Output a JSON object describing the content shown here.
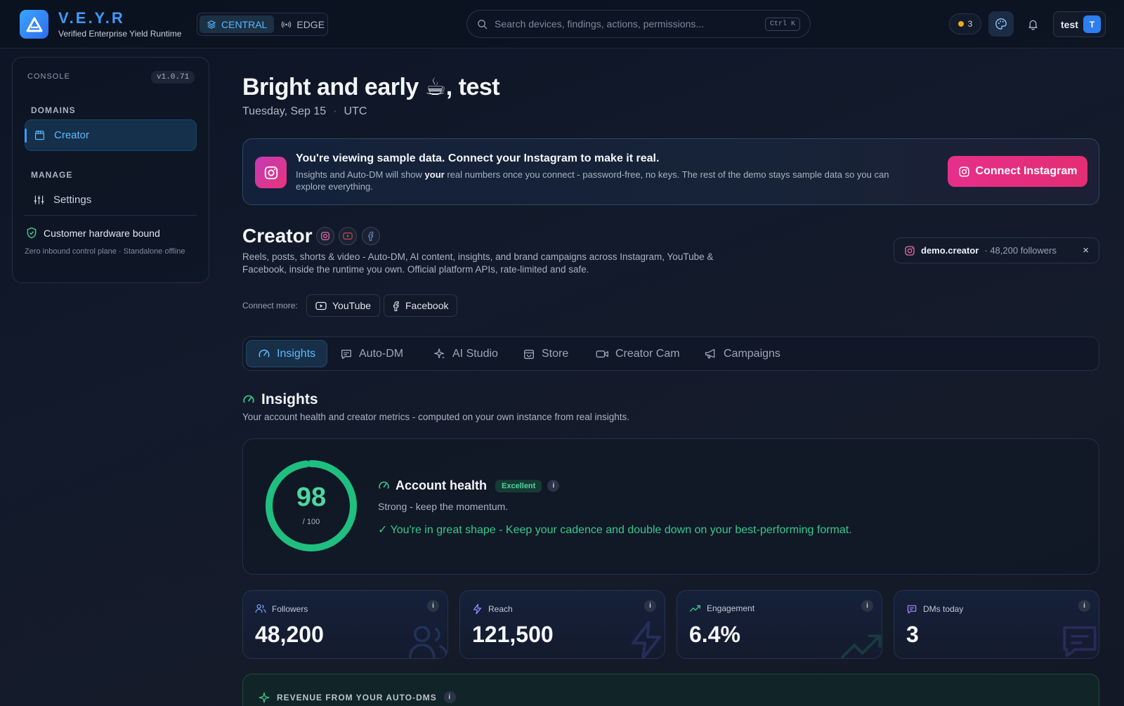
{
  "brand": {
    "name": "V.E.Y.R",
    "subtitle": "Verified Enterprise Yield Runtime"
  },
  "modes": [
    {
      "label": "CENTRAL",
      "active": true
    },
    {
      "label": "EDGE",
      "active": false
    }
  ],
  "search": {
    "placeholder": "Search devices, findings, actions, permissions...",
    "shortcut": "Ctrl K"
  },
  "notifications": {
    "count": "3"
  },
  "user": {
    "name": "test",
    "initial": "T"
  },
  "sidebar": {
    "console_label": "CONSOLE",
    "version": "v1.0.71",
    "domains_label": "DOMAINS",
    "domains": [
      {
        "label": "Creator",
        "active": true
      }
    ],
    "manage_label": "MANAGE",
    "manage": [
      {
        "label": "Settings"
      }
    ],
    "hardware": {
      "title": "Customer hardware bound",
      "subtitle": "Zero inbound control plane · Standalone offline"
    }
  },
  "greeting": {
    "text": "Bright and early ☕, test",
    "date": "Tuesday, Sep 15",
    "sep": "·",
    "tz": "UTC"
  },
  "banner": {
    "title": "You're viewing sample data. Connect your Instagram to make it real.",
    "body_before": "Insights and Auto-DM will show ",
    "body_bold": "your",
    "body_after": " real numbers once you connect - password-free, no keys. The rest of the demo stays sample data so you can explore everything.",
    "button": "Connect Instagram"
  },
  "creator": {
    "title": "Creator",
    "description": "Reels, posts, shorts & video - Auto-DM, AI content, insights, and brand campaigns across Instagram, YouTube & Facebook, inside the runtime you own. Official platform APIs, rate-limited and safe.",
    "account": {
      "handle": "demo.creator",
      "followers": "· 48,200 followers",
      "close": "×"
    },
    "connect_more_label": "Connect more:",
    "connect_more": [
      "YouTube",
      "Facebook"
    ]
  },
  "tabs": [
    {
      "label": "Insights",
      "icon": "gauge-icon",
      "active": true
    },
    {
      "label": "Auto-DM",
      "icon": "message-icon",
      "active": false
    },
    {
      "label": "AI Studio",
      "icon": "sparkle-icon",
      "active": false
    },
    {
      "label": "Store",
      "icon": "bag-icon",
      "active": false
    },
    {
      "label": "Creator Cam",
      "icon": "camera-icon",
      "active": false
    },
    {
      "label": "Campaigns",
      "icon": "megaphone-icon",
      "active": false
    }
  ],
  "insights": {
    "title": "Insights",
    "subtitle": "Your account health and creator metrics - computed on your own instance from real insights.",
    "health": {
      "score": "98",
      "score_value": 98,
      "score_max": "/ 100",
      "title": "Account health",
      "badge": "Excellent",
      "info": "i",
      "subtitle": "Strong - keep the momentum.",
      "tip": "✓ You're in great shape - Keep your cadence and double down on your best-performing format."
    },
    "stats": [
      {
        "label": "Followers",
        "value": "48,200",
        "info": "i"
      },
      {
        "label": "Reach",
        "value": "121,500",
        "info": "i"
      },
      {
        "label": "Engagement",
        "value": "6.4%",
        "info": "i"
      },
      {
        "label": "DMs today",
        "value": "3",
        "info": "i"
      }
    ],
    "revenue": {
      "title": "REVENUE FROM YOUR AUTO-DMS",
      "info": "i"
    }
  },
  "colors": {
    "accent": "#3d9bff",
    "success": "#4ed69d",
    "pink": "#e62f8a"
  }
}
